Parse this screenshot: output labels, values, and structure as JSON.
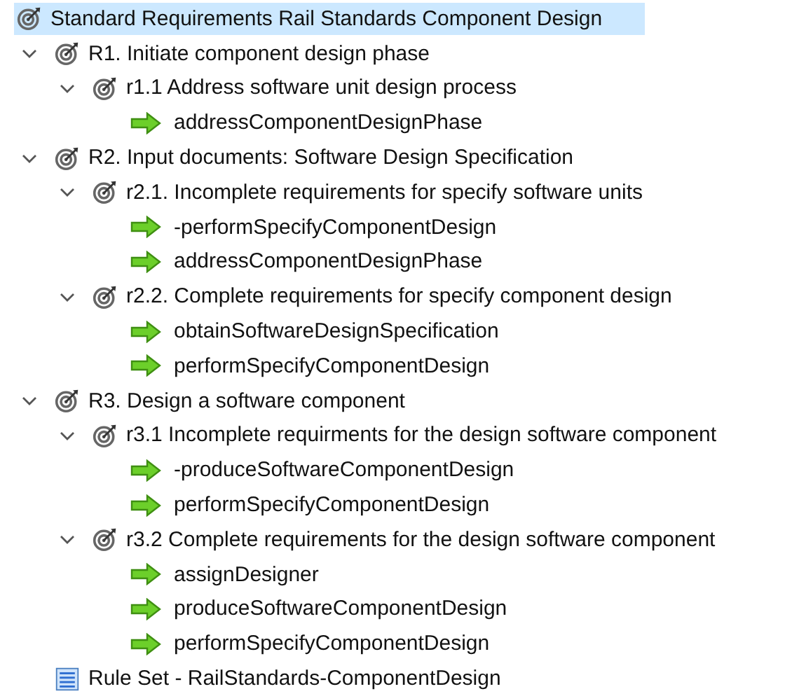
{
  "tree": [
    {
      "kind": "goal",
      "label": "Standard Requirements Rail Standards Component Design",
      "selected": true,
      "children": [
        {
          "kind": "goal",
          "label": "R1. Initiate component design phase",
          "selected": false,
          "expanded": true,
          "children": [
            {
              "kind": "goal",
              "label": "r1.1 Address software unit design process",
              "selected": false,
              "expanded": true,
              "children": [
                {
                  "kind": "action",
                  "label": "addressComponentDesignPhase",
                  "selected": false
                }
              ]
            }
          ]
        },
        {
          "kind": "goal",
          "label": "R2. Input documents: Software Design Specification",
          "selected": false,
          "expanded": true,
          "children": [
            {
              "kind": "goal",
              "label": "r2.1. Incomplete requirements for specify software units",
              "selected": false,
              "expanded": true,
              "children": [
                {
                  "kind": "action",
                  "label": "-performSpecifyComponentDesign",
                  "selected": false
                },
                {
                  "kind": "action",
                  "label": "addressComponentDesignPhase",
                  "selected": false
                }
              ]
            },
            {
              "kind": "goal",
              "label": "r2.2. Complete requirements for specify component design",
              "selected": false,
              "expanded": true,
              "children": [
                {
                  "kind": "action",
                  "label": "obtainSoftwareDesignSpecification",
                  "selected": false
                },
                {
                  "kind": "action",
                  "label": "performSpecifyComponentDesign",
                  "selected": false
                }
              ]
            }
          ]
        },
        {
          "kind": "goal",
          "label": "R3. Design a software component",
          "selected": false,
          "expanded": true,
          "children": [
            {
              "kind": "goal",
              "label": "r3.1 Incomplete requirments for the design software component",
              "selected": false,
              "expanded": true,
              "children": [
                {
                  "kind": "action",
                  "label": "-produceSoftwareComponentDesign",
                  "selected": false
                },
                {
                  "kind": "action",
                  "label": "performSpecifyComponentDesign",
                  "selected": false
                }
              ]
            },
            {
              "kind": "goal",
              "label": "r3.2 Complete requirements for the design software component",
              "selected": false,
              "expanded": true,
              "children": [
                {
                  "kind": "action",
                  "label": "assignDesigner",
                  "selected": false
                },
                {
                  "kind": "action",
                  "label": "produceSoftwareComponentDesign",
                  "selected": false
                },
                {
                  "kind": "action",
                  "label": "performSpecifyComponentDesign",
                  "selected": false
                }
              ]
            }
          ]
        },
        {
          "kind": "ruleset",
          "label": "Rule Set - RailStandards-ComponentDesign",
          "selected": false
        }
      ]
    }
  ]
}
